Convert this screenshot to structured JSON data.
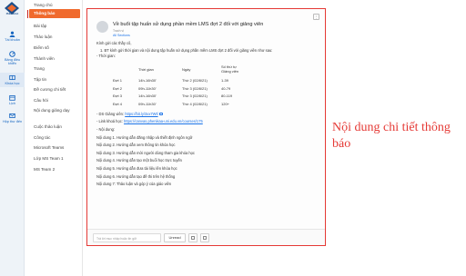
{
  "app": {
    "logo_text": "PHENIKAA",
    "accent_color": "#f06a2d",
    "highlight_color": "#e53935",
    "link_color": "#1a73e8"
  },
  "rail": [
    {
      "label": "Tài khoản",
      "icon": "user-icon"
    },
    {
      "label": "Bảng điều khiển",
      "icon": "dashboard-icon"
    },
    {
      "label": "Khóa học",
      "icon": "courses-icon"
    },
    {
      "label": "Lịch",
      "icon": "calendar-icon"
    },
    {
      "label": "Hộp thư đến",
      "icon": "inbox-icon"
    }
  ],
  "channels": [
    "Trang chủ",
    "Thông báo",
    "Bài tập",
    "Thảo luận",
    "Điểm số",
    "Thành viên",
    "Trang",
    "Tập tin",
    "Đề cương chi tiết",
    "Câu hỏi",
    "Nội dung giảng dạy",
    "Cuộc thảo luận",
    "Công tác",
    "Microsoft Teams",
    "Lớp MS Team 1",
    "MS Team 2"
  ],
  "post": {
    "title": "Về buổi tập huấn sử dụng phần mềm LMS đợt 2 đối với giảng viên",
    "author": "Trạch vị",
    "sections": "All Sections",
    "greeting": "Kính gửi các thầy cô,",
    "intro": "1. BT kính gửi thời gian và nội dung tập huấn sử dụng phần mềm LMS đợt 2 đối với giảng viên như sau:",
    "time_label": "- Thời gian:",
    "schedule": {
      "headers": [
        "",
        "Thời gian",
        "Ngày",
        "Số thứ tự Giảng viên"
      ],
      "rows": [
        [
          "Đợt 1",
          "14h-16h30'",
          "Thứ 2 (02/8/21)",
          "1-39"
        ],
        [
          "Đợt 2",
          "09h-11h30'",
          "Thứ 3 (02/8/21)",
          "40-79"
        ],
        [
          "Đợt 3",
          "14h-16h30'",
          "Thứ 3 (02/8/21)",
          "80-119"
        ],
        [
          "Đợt 4",
          "09h-11h30'",
          "Thứ 4 (02/8/21)",
          "120+"
        ]
      ]
    },
    "ds_label": "- DS Giảng viên:",
    "ds_link": "https://bit.ly/3xx7Wtl",
    "course_label": "- Link khoá học:",
    "course_link": "https://canvas.phenikaa-uni.edu.vn/courses/175",
    "content_label": "- Nội dung:",
    "contents": [
      "Nội dung 1. Hướng dẫn đăng nhập và thiết định ngôn ngữ",
      "Nội dung 2. Hướng dẫn xem thông tin khóa học",
      "Nội dung 3. Hướng dẫn mời người dùng tham gia khóa học",
      "Nội dung 4. Hướng dẫn tạo một buổi học trực tuyến",
      "Nội dung 5. Hướng dẫn đưa tài liệu lên khóa học",
      "Nội dung 6. Hướng dẫn tạo đề thi trên hệ thống",
      "Nội dung 7: Thảo luận và góp ý của giáo viên"
    ]
  },
  "reply": {
    "placeholder": "Trả lời mục nhập hoặc tin gửi",
    "unread_label": "Unread"
  },
  "annotation": "Nội dung chi tiết thông báo"
}
